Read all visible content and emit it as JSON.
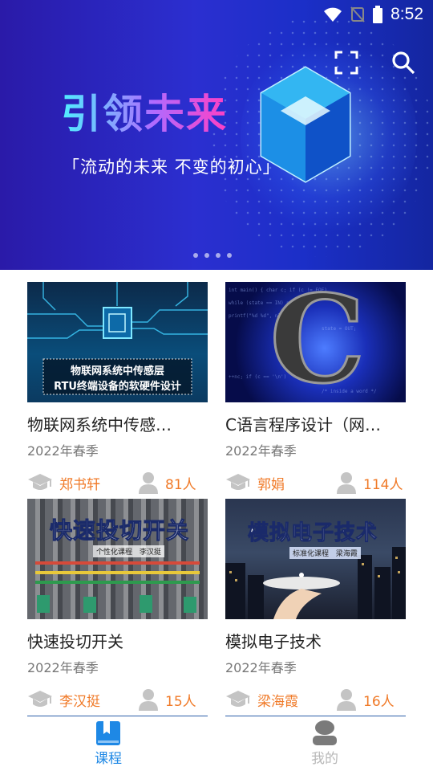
{
  "status_bar": {
    "time": "8:52"
  },
  "banner": {
    "headline": "引领未来",
    "subline": "「流动的未来 不变的初心」",
    "slides": 4
  },
  "courses": [
    {
      "title": "物联网系统中传感…",
      "term": "2022年春季",
      "teacher": "郑书轩",
      "students": "81人",
      "thumb": {
        "kind": "circuit",
        "caption_lines": [
          "物联网系统中传感层",
          "RTU终端设备的软硬件设计"
        ]
      }
    },
    {
      "title": "C语言程序设计（网…",
      "term": "2022年春季",
      "teacher": "郭娟",
      "students": "114人",
      "thumb": {
        "kind": "c-language",
        "letter": "C"
      }
    },
    {
      "title": "快速投切开关",
      "term": "2022年春季",
      "teacher": "李汉挺",
      "students": "15人",
      "thumb": {
        "kind": "switchgear",
        "heading": "快速投切开关",
        "tag1": "个性化课程",
        "tag2": "李汉挺"
      }
    },
    {
      "title": "模拟电子技术",
      "term": "2022年春季",
      "teacher": "梁海霞",
      "students": "16人",
      "thumb": {
        "kind": "city",
        "heading": "模拟电子技术",
        "tag1": "标准化课程",
        "tag2": "梁海霞"
      }
    }
  ],
  "tabs": [
    {
      "label": "课程",
      "active": true,
      "icon": "book-icon"
    },
    {
      "label": "我的",
      "active": false,
      "icon": "user-icon"
    }
  ],
  "colors": {
    "accent": "#1e88e5",
    "orange": "#f07a28",
    "grey_icon": "#c4c4c4"
  }
}
